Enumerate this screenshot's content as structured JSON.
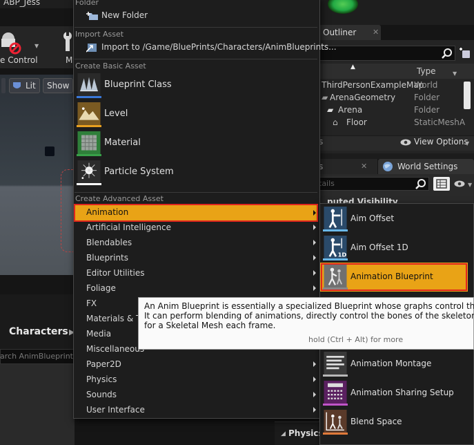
{
  "window": {
    "tab_title": "ABP_Jess"
  },
  "toolbar": {
    "source_control_label": "e Control",
    "next_label": "M"
  },
  "viewport": {
    "lit_label": "Lit",
    "show_label": "Show"
  },
  "content_browser": {
    "path_item": "Characters",
    "search_placeholder": "arch AnimBlueprints"
  },
  "outliner": {
    "tab_label": "Outliner",
    "close_glyph": "✕",
    "type_column": "Type",
    "rows": [
      {
        "name": "ThirdPersonExampleMap",
        "type": "World"
      },
      {
        "name": "ArenaGeometry",
        "type": "Folder"
      },
      {
        "name": "Arena",
        "type": "Folder"
      },
      {
        "name": "Floor",
        "type": "StaticMeshA"
      }
    ],
    "footer_count": "s",
    "view_options": "View Options"
  },
  "details": {
    "tab_label": "s",
    "world_settings_tab": "World Settings",
    "search_placeholder": "tails",
    "section_title": "puted Visibility"
  },
  "physics_bar": {
    "label": "Physics"
  },
  "menu": {
    "folder_header": "Folder",
    "new_folder": "New Folder",
    "import_header": "Import Asset",
    "import_item": "Import to /Game/BluePrints/Characters/AnimBlueprints...",
    "basic_header": "Create Basic Asset",
    "basic_items": [
      {
        "label": "Blueprint Class",
        "icon": "blueprint-class-icon"
      },
      {
        "label": "Level",
        "icon": "level-icon"
      },
      {
        "label": "Material",
        "icon": "material-icon"
      },
      {
        "label": "Particle System",
        "icon": "particle-system-icon"
      }
    ],
    "advanced_header": "Create Advanced Asset",
    "advanced_items": [
      "Animation",
      "Artificial Intelligence",
      "Blendables",
      "Blueprints",
      "Editor Utilities",
      "Foliage",
      "FX",
      "Materials & Te",
      "Media",
      "Miscellaneous",
      "Paper2D",
      "Physics",
      "Sounds",
      "User Interface"
    ]
  },
  "submenu": {
    "items": [
      {
        "label": "Aim Offset",
        "icon": "aim-offset-icon"
      },
      {
        "label": "Aim Offset 1D",
        "icon": "aim-offset-1d-icon"
      },
      {
        "label": "Animation Blueprint",
        "icon": "animation-blueprint-icon"
      },
      {
        "label": "Animation Montage",
        "icon": "animation-montage-icon"
      },
      {
        "label": "Animation Sharing Setup",
        "icon": "animation-sharing-setup-icon"
      },
      {
        "label": "Blend Space",
        "icon": "blend-space-icon"
      }
    ]
  },
  "tooltip": {
    "description": "An Anim Blueprint is essentially a specialized Blueprint whose graphs control the animatio\nIt can perform blending of animations, directly control the bones of the skeleton, and outpu\nfor a Skeletal Mesh each frame.",
    "hint": "hold (Ctrl + Alt) for more"
  },
  "colors": {
    "highlight": "#e9a316",
    "highlight_border": "#e0261e",
    "menu_bg": "#1d1d1d",
    "tooltip_bg": "#fafafa"
  }
}
